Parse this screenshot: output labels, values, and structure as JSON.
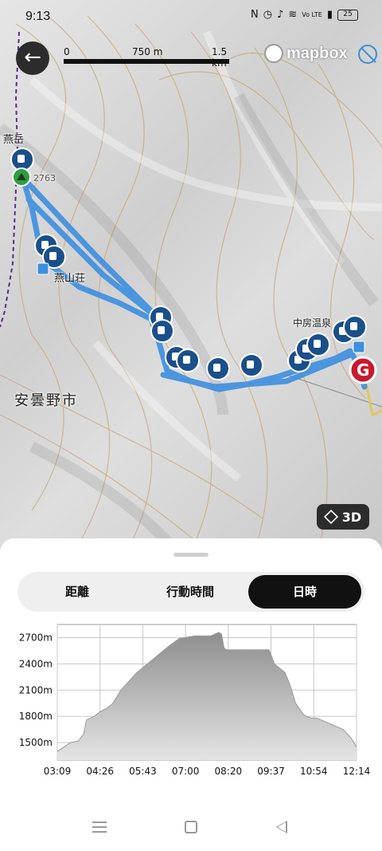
{
  "status_bar": {
    "time": "9:13",
    "network": "Vo LTE",
    "battery": "25"
  },
  "map": {
    "scale": {
      "zero": "0",
      "mid": "750 m",
      "max": "1.5 km"
    },
    "attribution": "mapbox",
    "labels": {
      "peak": "燕岳",
      "elevation": "2763",
      "hut": "燕山荘",
      "onsen": "中房温泉",
      "city": "安曇野市"
    },
    "goal_marker": "G",
    "button_3d": "3D"
  },
  "tabs": {
    "distance": "距離",
    "duration": "行動時間",
    "datetime": "日時",
    "active": "datetime"
  },
  "chart_data": {
    "type": "area",
    "title": "",
    "xlabel": "",
    "ylabel": "",
    "x_ticks": [
      "03:09",
      "04:26",
      "05:43",
      "07:00",
      "08:20",
      "09:37",
      "10:54",
      "12:14"
    ],
    "y_ticks": [
      "1500m",
      "1800m",
      "2100m",
      "2400m",
      "2700m"
    ],
    "ylim": [
      1300,
      2850
    ],
    "x_minutes": [
      0,
      25,
      40,
      50,
      55,
      70,
      80,
      95,
      105,
      120,
      150,
      180,
      210,
      230,
      240,
      260,
      290,
      305,
      310,
      315,
      320,
      400,
      410,
      420,
      430,
      440,
      450,
      465,
      470,
      480,
      490,
      540,
      555,
      560,
      565
    ],
    "values": [
      1400,
      1500,
      1520,
      1600,
      1760,
      1800,
      1850,
      1900,
      1950,
      2100,
      2300,
      2450,
      2600,
      2690,
      2700,
      2720,
      2720,
      2760,
      2740,
      2580,
      2560,
      2560,
      2400,
      2350,
      2300,
      2150,
      1950,
      1820,
      1800,
      1780,
      1780,
      1650,
      1550,
      1500,
      1450
    ],
    "grid": true,
    "series": [
      {
        "name": "",
        "color": "#b8b8b8"
      }
    ]
  },
  "colors": {
    "route": "#3d8fe0",
    "marker": "#1b4f8a",
    "goal": "#c8192e",
    "start": "#2e9e3e"
  },
  "icons": {
    "back": "arrow-left-icon",
    "three_d": "cube-icon",
    "marker": "mug-icon"
  }
}
